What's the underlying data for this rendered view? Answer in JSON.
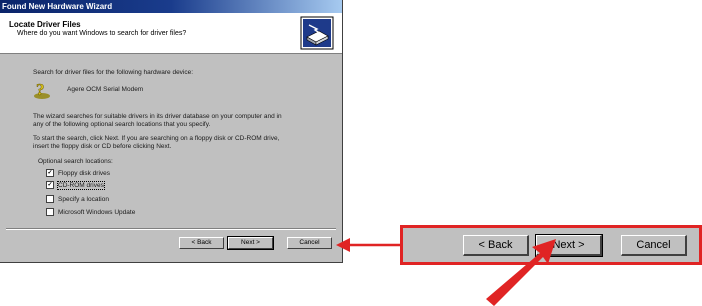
{
  "window": {
    "title": "Found New Hardware Wizard",
    "header_title": "Locate Driver Files",
    "header_subtitle": "Where do you want Windows to search for driver files?"
  },
  "content": {
    "intro": "Search for driver files for the following hardware device:",
    "device_name": "Agere OCM Serial Modem",
    "description_1": "The wizard searches for suitable drivers in its driver database on your computer and in",
    "description_2": "any of the following optional search locations that you specify.",
    "instruction_1": "To start the search, click Next. If you are searching on a floppy disk or CD-ROM drive,",
    "instruction_2": "insert the floppy disk or CD before clicking Next.",
    "optional_label": "Optional search locations:",
    "options": [
      {
        "label": "Floppy disk drives",
        "checked": true
      },
      {
        "label": "CD-ROM drives",
        "checked": true
      },
      {
        "label": "Specify a location",
        "checked": false
      },
      {
        "label": "Microsoft Windows Update",
        "checked": false
      }
    ]
  },
  "buttons": {
    "back": "< Back",
    "next": "Next >",
    "cancel": "Cancel"
  },
  "callout": {
    "back": "< Back",
    "next": "Next >",
    "cancel": "Cancel"
  },
  "colors": {
    "titlebar_start": "#0a246a",
    "titlebar_end": "#a6caf0",
    "dialog_bg": "#c0c0c0",
    "highlight_red": "#e02424"
  },
  "icons": {
    "header": "hardware-wizard-icon",
    "device": "question-device-icon",
    "callout_arrow": "red-pointer-arrow"
  }
}
